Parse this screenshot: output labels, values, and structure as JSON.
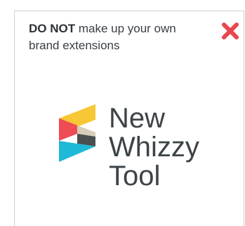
{
  "caption": {
    "emphasis": "DO NOT",
    "rest": " make up your own brand extensions"
  },
  "status": {
    "icon": "cross-icon",
    "color": "#e8464e"
  },
  "logo": {
    "icon": "stacked-chevron-logo",
    "colors": {
      "yellow": "#f7c736",
      "red": "#ee4b55",
      "beige": "#d8cdb8",
      "dark": "#4a4f52",
      "cyan": "#1fb9d8"
    },
    "word1": "New",
    "word2": "Whizzy",
    "word3": "Tool"
  }
}
